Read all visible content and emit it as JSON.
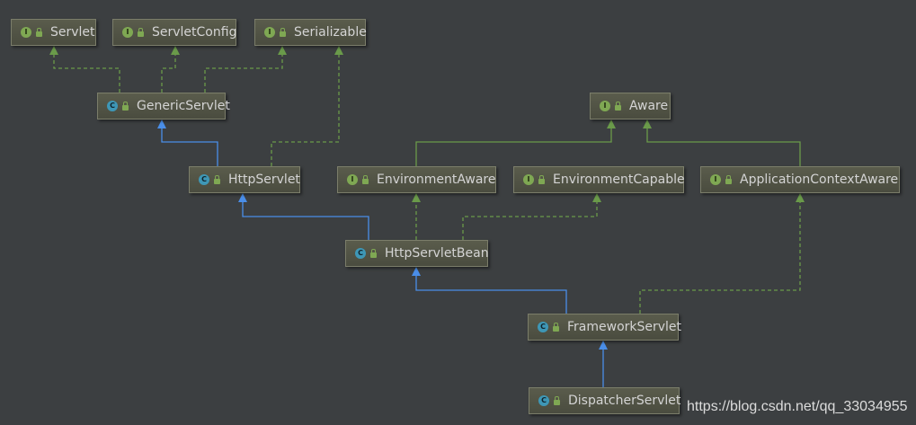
{
  "nodes": [
    {
      "id": "servlet",
      "label": "Servlet",
      "kind": "I"
    },
    {
      "id": "servlet-config",
      "label": "ServletConfig",
      "kind": "I"
    },
    {
      "id": "serializable",
      "label": "Serializable",
      "kind": "I"
    },
    {
      "id": "generic-servlet",
      "label": "GenericServlet",
      "kind": "C"
    },
    {
      "id": "aware",
      "label": "Aware",
      "kind": "I"
    },
    {
      "id": "http-servlet",
      "label": "HttpServlet",
      "kind": "C"
    },
    {
      "id": "environment-aware",
      "label": "EnvironmentAware",
      "kind": "I"
    },
    {
      "id": "environment-capable",
      "label": "EnvironmentCapable",
      "kind": "I"
    },
    {
      "id": "application-context-aware",
      "label": "ApplicationContextAware",
      "kind": "I"
    },
    {
      "id": "http-servlet-bean",
      "label": "HttpServletBean",
      "kind": "C"
    },
    {
      "id": "framework-servlet",
      "label": "FrameworkServlet",
      "kind": "C"
    },
    {
      "id": "dispatcher-servlet",
      "label": "DispatcherServlet",
      "kind": "C"
    }
  ],
  "edges": [
    {
      "from": "generic-servlet",
      "to": "servlet",
      "type": "implements"
    },
    {
      "from": "generic-servlet",
      "to": "servlet-config",
      "type": "implements"
    },
    {
      "from": "generic-servlet",
      "to": "serializable",
      "type": "implements"
    },
    {
      "from": "http-servlet",
      "to": "generic-servlet",
      "type": "extends"
    },
    {
      "from": "http-servlet",
      "to": "serializable",
      "type": "implements"
    },
    {
      "from": "environment-aware",
      "to": "aware",
      "type": "extends"
    },
    {
      "from": "application-context-aware",
      "to": "aware",
      "type": "extends"
    },
    {
      "from": "http-servlet-bean",
      "to": "http-servlet",
      "type": "extends"
    },
    {
      "from": "http-servlet-bean",
      "to": "environment-aware",
      "type": "implements"
    },
    {
      "from": "http-servlet-bean",
      "to": "environment-capable",
      "type": "implements"
    },
    {
      "from": "framework-servlet",
      "to": "http-servlet-bean",
      "type": "extends"
    },
    {
      "from": "framework-servlet",
      "to": "application-context-aware",
      "type": "implements"
    },
    {
      "from": "dispatcher-servlet",
      "to": "framework-servlet",
      "type": "extends"
    }
  ],
  "kind_icons": {
    "I": "interface-icon",
    "C": "class-icon"
  },
  "colors": {
    "background": "#3c3f41",
    "extends_class": "#4a8ee8",
    "implements_or_interface_extends": "#6a9a4a"
  },
  "watermark": "https://blog.csdn.net/qq_33034955"
}
